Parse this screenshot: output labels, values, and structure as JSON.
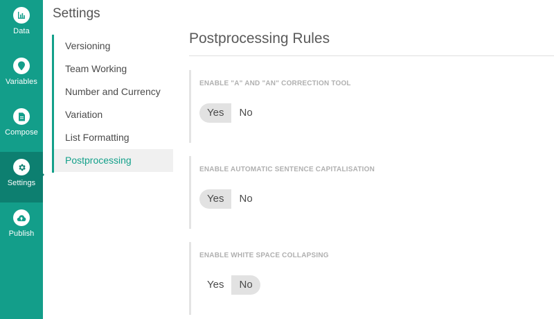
{
  "rail": {
    "items": [
      {
        "label": "Data",
        "icon": "chart-icon"
      },
      {
        "label": "Variables",
        "icon": "map-pin-icon"
      },
      {
        "label": "Compose",
        "icon": "document-icon"
      },
      {
        "label": "Settings",
        "icon": "gear-icon",
        "active": true
      },
      {
        "label": "Publish",
        "icon": "cloud-upload-icon"
      }
    ],
    "colors": {
      "background": "#139e8a",
      "active": "#0d7f70"
    }
  },
  "settings": {
    "title": "Settings",
    "nav": [
      {
        "label": "Versioning"
      },
      {
        "label": "Team Working"
      },
      {
        "label": "Number and Currency"
      },
      {
        "label": "Variation"
      },
      {
        "label": "List Formatting"
      },
      {
        "label": "Postprocessing",
        "active": true
      }
    ]
  },
  "main": {
    "title": "Postprocessing Rules",
    "rules": [
      {
        "label": "ENABLE \"A\" AND \"AN\" CORRECTION TOOL",
        "yes": "Yes",
        "no": "No",
        "selected": "Yes"
      },
      {
        "label": "ENABLE AUTOMATIC SENTENCE CAPITALISATION",
        "yes": "Yes",
        "no": "No",
        "selected": "Yes"
      },
      {
        "label": "ENABLE WHITE SPACE COLLAPSING",
        "yes": "Yes",
        "no": "No",
        "selected": "No"
      }
    ]
  },
  "accent_color": "#13a08a"
}
